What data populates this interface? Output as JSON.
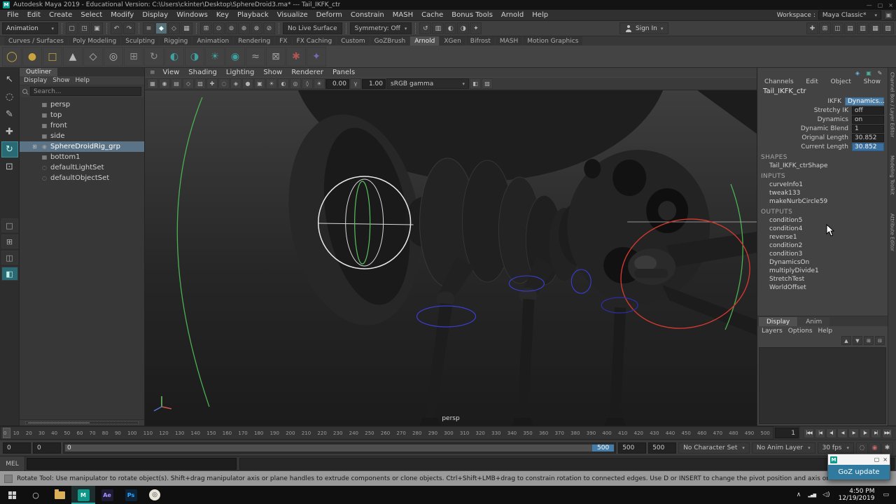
{
  "window": {
    "icon_glyph": "M",
    "title": "Autodesk Maya 2019 - Educational Version: C:\\Users\\ckinter\\Desktop\\SphereDroid3.ma* --- Tail_IKFK_ctr",
    "minimize_glyph": "—",
    "maximize_glyph": "▢",
    "close_glyph": "×"
  },
  "ui": {
    "chevron_down": "▾",
    "panel_menu": "≡",
    "sun": "☀",
    "gamma": "γ",
    "lock": "▣"
  },
  "menu_bar": {
    "items": [
      "File",
      "Edit",
      "Create",
      "Select",
      "Modify",
      "Display",
      "Windows",
      "Key",
      "Playback",
      "Visualize",
      "Deform",
      "Constrain",
      "MASH",
      "Cache",
      "Bonus Tools",
      "Arnold",
      "Help"
    ],
    "workspace_label": "Workspace :",
    "workspace_value": "Maya Classic*"
  },
  "status_line": {
    "mode_selector": "Animation",
    "file_icons": [
      {
        "name": "new-scene-icon",
        "glyph": "▢"
      },
      {
        "name": "open-scene-icon",
        "glyph": "◳"
      },
      {
        "name": "save-scene-icon",
        "glyph": "▣"
      }
    ],
    "edit_icons": [
      {
        "name": "undo-icon",
        "glyph": "↶"
      },
      {
        "name": "redo-icon",
        "glyph": "↷"
      }
    ],
    "selection_icons": [
      {
        "name": "select-hierarchy-icon",
        "glyph": "≡"
      },
      {
        "name": "select-object-icon",
        "glyph": "◆",
        "active": true
      },
      {
        "name": "select-component-icon",
        "glyph": "◇"
      },
      {
        "name": "select-by-type-icon",
        "glyph": "▦"
      }
    ],
    "snap_icons": [
      {
        "name": "snap-to-grid-icon",
        "glyph": "⊞"
      },
      {
        "name": "snap-to-curve-icon",
        "glyph": "⊙"
      },
      {
        "name": "snap-to-point-icon",
        "glyph": "⊚"
      },
      {
        "name": "snap-to-plane-icon",
        "glyph": "⊕"
      },
      {
        "name": "snap-to-view-plane-icon",
        "glyph": "⊗"
      },
      {
        "name": "make-live-icon",
        "glyph": "⊘"
      }
    ],
    "live_surface": "No Live Surface",
    "symmetry": "Symmetry: Off",
    "history_icons": [
      {
        "name": "construction-history-icon",
        "glyph": "↺"
      },
      {
        "name": "open-render-view-icon",
        "glyph": "▥"
      },
      {
        "name": "render-current-frame-icon",
        "glyph": "◐"
      },
      {
        "name": "ipr-render-icon",
        "glyph": "◑"
      },
      {
        "name": "render-settings-icon",
        "glyph": "✦"
      }
    ],
    "sign_in_label": "Sign In",
    "right_icons": [
      {
        "name": "show-manipulators-icon",
        "glyph": "✚"
      },
      {
        "name": "grid-toggle-icon",
        "glyph": "⊞"
      },
      {
        "name": "panel-layout-icon",
        "glyph": "◫"
      },
      {
        "name": "outliner-toggle-icon",
        "glyph": "▤"
      },
      {
        "name": "attribute-editor-toggle-icon",
        "glyph": "▥"
      },
      {
        "name": "tool-settings-toggle-icon",
        "glyph": "▦"
      },
      {
        "name": "channel-box-toggle-icon",
        "glyph": "▧"
      }
    ]
  },
  "shelf": {
    "tabs": [
      {
        "label": "Curves / Surfaces"
      },
      {
        "label": "Poly Modeling"
      },
      {
        "label": "Sculpting"
      },
      {
        "label": "Rigging"
      },
      {
        "label": "Animation"
      },
      {
        "label": "Rendering"
      },
      {
        "label": "FX"
      },
      {
        "label": "FX Caching"
      },
      {
        "label": "Custom"
      },
      {
        "label": "GoZBrush"
      },
      {
        "label": "Arnold",
        "active": true
      },
      {
        "label": "XGen"
      },
      {
        "label": "Bifrost"
      },
      {
        "label": "MASH"
      },
      {
        "label": "Motion Graphics"
      }
    ],
    "icons": [
      {
        "name": "shelf-sphere-tool-icon",
        "glyph": "◯",
        "color": "#c9a43e"
      },
      {
        "name": "shelf-circle-tool-icon",
        "glyph": "●",
        "color": "#c9a43e"
      },
      {
        "name": "shelf-square-tool-icon",
        "glyph": "□",
        "color": "#c9a43e"
      },
      {
        "name": "shelf-cone-tool-icon",
        "glyph": "▲",
        "color": "#b9b9b9"
      },
      {
        "name": "shelf-plane-tool-icon",
        "glyph": "◇",
        "color": "#b9b9b9"
      },
      {
        "name": "shelf-torus-tool-icon",
        "glyph": "◎",
        "color": "#b9b9b9"
      },
      {
        "name": "shelf-group-tool-icon",
        "glyph": "⊞",
        "color": "#8f8f8f"
      },
      {
        "name": "shelf-history-tool-icon",
        "glyph": "↻",
        "color": "#8f8f8f"
      },
      {
        "name": "shelf-render-tool-icon",
        "glyph": "◐",
        "color": "#3fa0a0"
      },
      {
        "name": "shelf-ipr-tool-icon",
        "glyph": "◑",
        "color": "#3fa0a0"
      },
      {
        "name": "shelf-light-tool-icon",
        "glyph": "☀",
        "color": "#3fa0a0"
      },
      {
        "name": "shelf-material-tool-icon",
        "glyph": "◉",
        "color": "#3fa0a0"
      },
      {
        "name": "shelf-curve-tool-icon",
        "glyph": "≈",
        "color": "#9f9f9f"
      },
      {
        "name": "shelf-extrude-tool-icon",
        "glyph": "⊠",
        "color": "#9f9f9f"
      },
      {
        "name": "shelf-star-tool-icon",
        "glyph": "✱",
        "color": "#b05555"
      },
      {
        "name": "shelf-misc-tool-icon",
        "glyph": "✦",
        "color": "#7a6ab0"
      }
    ]
  },
  "toolbox": {
    "tools": [
      {
        "name": "select-tool-icon",
        "glyph": "↖"
      },
      {
        "name": "lasso-tool-icon",
        "glyph": "◌"
      },
      {
        "name": "paint-selection-tool-icon",
        "glyph": "✎"
      },
      {
        "name": "move-tool-icon",
        "glyph": "✚"
      },
      {
        "name": "rotate-tool-icon",
        "glyph": "↻",
        "active": true
      },
      {
        "name": "scale-tool-icon",
        "glyph": "⊡"
      }
    ],
    "layouts": [
      {
        "name": "layout-single-pane-icon",
        "glyph": "□"
      },
      {
        "name": "layout-four-pane-icon",
        "glyph": "⊞"
      },
      {
        "name": "layout-two-pane-icon",
        "glyph": "◫"
      },
      {
        "name": "layout-persp-outliner-icon",
        "glyph": "◧",
        "active": true
      }
    ]
  },
  "outliner": {
    "tab_label": "Outliner",
    "menus": [
      "Display",
      "Show",
      "Help"
    ],
    "search_placeholder": "Search...",
    "items": [
      {
        "label": "persp",
        "glyph": "▦",
        "expander": ""
      },
      {
        "label": "top",
        "glyph": "▦",
        "expander": ""
      },
      {
        "label": "front",
        "glyph": "▦",
        "expander": ""
      },
      {
        "label": "side",
        "glyph": "▦",
        "expander": ""
      },
      {
        "label": "SphereDroidRig_grp",
        "glyph": "◉",
        "expander": "⊞",
        "selected": true
      },
      {
        "label": "bottom1",
        "glyph": "▦",
        "expander": ""
      },
      {
        "label": "defaultLightSet",
        "glyph": "◌",
        "expander": ""
      },
      {
        "label": "defaultObjectSet",
        "glyph": "◌",
        "expander": ""
      }
    ]
  },
  "viewport": {
    "menus": [
      "View",
      "Shading",
      "Lighting",
      "Show",
      "Renderer",
      "Panels"
    ],
    "toolbar_icons": [
      {
        "name": "select-camera-icon",
        "glyph": "▦"
      },
      {
        "name": "lock-camera-icon",
        "glyph": "◉"
      },
      {
        "name": "camera-attributes-icon",
        "glyph": "▤"
      },
      {
        "name": "bookmarks-icon",
        "glyph": "◇"
      },
      {
        "name": "image-plane-icon",
        "glyph": "▧"
      },
      {
        "name": "2d-pan-zoom-icon",
        "glyph": "✚"
      },
      {
        "name": "oversampling-icon",
        "glyph": "◌"
      },
      {
        "name": "wireframe-icon",
        "glyph": "◈"
      },
      {
        "name": "smooth-shade-icon",
        "glyph": "●"
      },
      {
        "name": "textured-icon",
        "glyph": "▣"
      },
      {
        "name": "lighting-icon",
        "glyph": "☀"
      },
      {
        "name": "shadows-icon",
        "glyph": "◐"
      },
      {
        "name": "occlusion-icon",
        "glyph": "◎"
      },
      {
        "name": "motion-blur-icon",
        "glyph": "◊"
      }
    ],
    "exposure": "0.00",
    "gamma": "1.00",
    "view_transform": "sRGB gamma",
    "toolbar_icons_right": [
      {
        "name": "isolate-select-icon",
        "glyph": "◧"
      },
      {
        "name": "xray-icon",
        "glyph": "▨"
      }
    ],
    "camera_label": "persp",
    "overlay_colors": {
      "selection_white": "#eaeaea",
      "curve_green": "#4cb052",
      "rotate_red": "#cf3a30",
      "joint_blue": "#3d3dd6"
    }
  },
  "channel_box": {
    "top_icons": [
      {
        "name": "pin-panel-icon",
        "glyph": "◈",
        "color": "#6fb3e0"
      },
      {
        "name": "copy-tab-icon",
        "glyph": "▣",
        "color": "#4fae9f"
      },
      {
        "name": "edit-pencil-icon",
        "glyph": "✎",
        "color": "#bdbdbd"
      }
    ],
    "menus": [
      "Channels",
      "Edit",
      "Object",
      "Show"
    ],
    "object_name": "Tail_IKFK_ctr",
    "attributes": [
      {
        "label": "IKFK",
        "value": "Dynamics...",
        "highlight": true
      },
      {
        "label": "Stretchy IK",
        "value": "off"
      },
      {
        "label": "Dynamics",
        "value": "on"
      },
      {
        "label": "Dynamic Blend",
        "value": "1"
      },
      {
        "label": "Orignal Length",
        "value": "30.852"
      },
      {
        "label": "Current Length",
        "value": "30.852",
        "editing": true
      }
    ],
    "nodes": [
      {
        "label": "SHAPES",
        "type": "header"
      },
      {
        "label": "Tail_IKFK_ctrShape",
        "type": "node"
      },
      {
        "label": "INPUTS",
        "type": "header"
      },
      {
        "label": "curveInfo1",
        "type": "node"
      },
      {
        "label": "tweak133",
        "type": "node"
      },
      {
        "label": "makeNurbCircle59",
        "type": "node"
      },
      {
        "label": "OUTPUTS",
        "type": "header"
      },
      {
        "label": "condition5",
        "type": "node"
      },
      {
        "label": "condition4",
        "type": "node"
      },
      {
        "label": "reverse1",
        "type": "node"
      },
      {
        "label": "condition2",
        "type": "node"
      },
      {
        "label": "condition3",
        "type": "node"
      },
      {
        "label": "DynamicsOn",
        "type": "node"
      },
      {
        "label": "multiplyDivide1",
        "type": "node"
      },
      {
        "label": "StretchTest",
        "type": "node"
      },
      {
        "label": "WorldOffset",
        "type": "node"
      }
    ]
  },
  "layer_editor": {
    "tabs": [
      {
        "label": "Display",
        "active": true
      },
      {
        "label": "Anim"
      }
    ],
    "menus": [
      "Layers",
      "Options",
      "Help"
    ],
    "icons": [
      {
        "name": "move-layer-up-icon",
        "glyph": "▲"
      },
      {
        "name": "move-layer-down-icon",
        "glyph": "▼"
      },
      {
        "name": "empty-layer-icon",
        "glyph": "⊞"
      },
      {
        "name": "layer-from-selected-icon",
        "glyph": "⊟"
      }
    ]
  },
  "right_tabs": [
    "Channel Box / Layer Editor",
    "Modeling Toolkit",
    "Attribute Editor"
  ],
  "time_slider": {
    "ticks": [
      0,
      10,
      20,
      30,
      40,
      50,
      60,
      70,
      80,
      90,
      100,
      110,
      120,
      130,
      140,
      150,
      160,
      170,
      180,
      190,
      200,
      210,
      220,
      230,
      240,
      250,
      260,
      270,
      280,
      290,
      300,
      310,
      320,
      330,
      340,
      350,
      360,
      370,
      380,
      390,
      400,
      410,
      420,
      430,
      440,
      450,
      460,
      470,
      480,
      490,
      500
    ],
    "current_frame": "1",
    "playback_buttons": [
      {
        "name": "go-to-start-button",
        "glyph": "|◀◀"
      },
      {
        "name": "step-back-frame-button",
        "glyph": "|◀"
      },
      {
        "name": "step-back-key-button",
        "glyph": "◀|"
      },
      {
        "name": "play-backwards-button",
        "glyph": "◀"
      },
      {
        "name": "play-forwards-button",
        "glyph": "▶"
      },
      {
        "name": "step-forward-key-button",
        "glyph": "|▶"
      },
      {
        "name": "step-forward-frame-button",
        "glyph": "▶|"
      },
      {
        "name": "go-to-end-button",
        "glyph": "▶▶|"
      }
    ]
  },
  "range_slider": {
    "animation_start": "0",
    "playback_start": "0",
    "slider_start_label": "0",
    "slider_end_label": "500",
    "playback_end": "500",
    "animation_end": "500",
    "character_set": "No Character Set",
    "anim_layer": "No Anim Layer",
    "fps": "30 fps",
    "icons": [
      {
        "name": "mute-playback-icon",
        "glyph": "◌"
      },
      {
        "name": "auto-keyframe-icon",
        "glyph": "◉",
        "color": "#c96a6a"
      },
      {
        "name": "animation-preferences-icon",
        "glyph": "✱"
      }
    ]
  },
  "command_line": {
    "label": "MEL"
  },
  "help_line": {
    "text": "Rotate Tool: Use manipulator to rotate object(s). Shift+drag manipulator axis or plane handles to extrude components or clone objects. Ctrl+Shift+LMB+drag to constrain rotation to connected edges. Use D or INSERT to change the pivot position and axis orientation."
  },
  "taskbar": {
    "search_glyph": "○",
    "maya_glyph": "M",
    "ae_glyph": "Ae",
    "ps_glyph": "Ps",
    "zbrush_glyph": "◎",
    "tray_chevron": "∧",
    "network_glyph": "▂▄▆",
    "volume_glyph": "◁)",
    "notification_glyph": "▭",
    "clock_time": "4:50 PM",
    "clock_date": "12/19/2019"
  },
  "goz_popup": {
    "icon_glyph": "M",
    "maximize_glyph": "▢",
    "close_glyph": "×",
    "button_label": "GoZ update"
  }
}
